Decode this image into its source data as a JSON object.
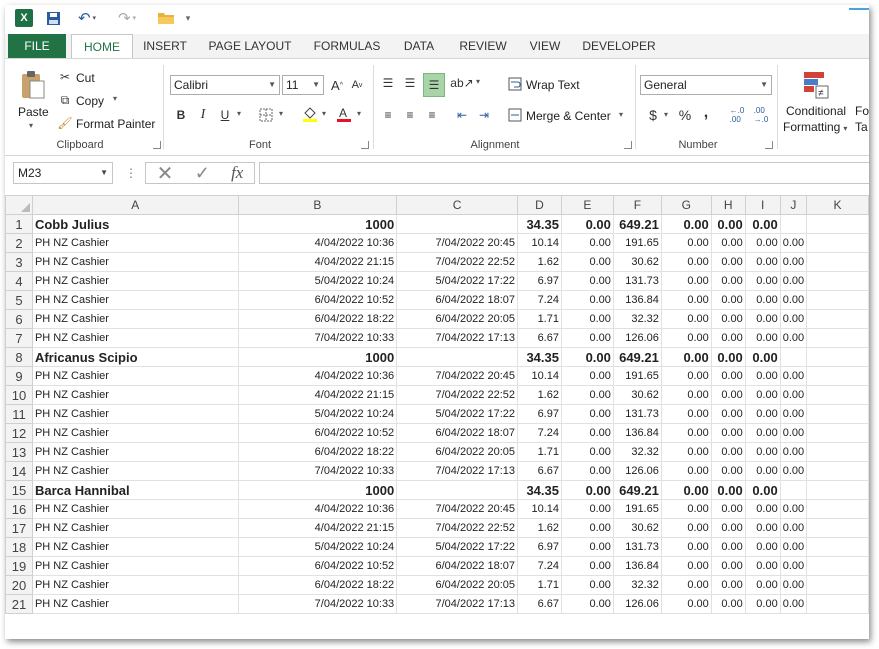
{
  "quick_access": {
    "excel_logo": "X"
  },
  "tabs": [
    "FILE",
    "HOME",
    "INSERT",
    "PAGE LAYOUT",
    "FORMULAS",
    "DATA",
    "REVIEW",
    "VIEW",
    "DEVELOPER"
  ],
  "ribbon": {
    "clipboard": {
      "paste": "Paste",
      "cut": "Cut",
      "copy": "Copy",
      "format_painter": "Format Painter",
      "label": "Clipboard"
    },
    "font": {
      "name": "Calibri",
      "size": "11",
      "bold": "B",
      "italic": "I",
      "underline": "U",
      "label": "Font"
    },
    "alignment": {
      "wrap_text": "Wrap Text",
      "merge_center": "Merge & Center",
      "label": "Alignment"
    },
    "number": {
      "format": "General",
      "currency": "$",
      "percent": "%",
      "comma": ",",
      "label": "Number"
    },
    "styles": {
      "conditional_formatting_1": "Conditional",
      "conditional_formatting_2": "Formatting",
      "format_as_1": "Fo",
      "format_as_2": "Ta"
    }
  },
  "formula_bar": {
    "name_box": "M23",
    "fx": "fx",
    "formula": ""
  },
  "columns": [
    "A",
    "B",
    "C",
    "D",
    "E",
    "F",
    "G",
    "H",
    "I",
    "J",
    "K"
  ],
  "rows": [
    {
      "n": "1",
      "hdr": true,
      "cells": [
        "Cobb Julius",
        "1000",
        "",
        "34.35",
        "0.00",
        "649.21",
        "0.00",
        "0.00",
        "0.00",
        "",
        ""
      ]
    },
    {
      "n": "2",
      "hdr": false,
      "cells": [
        "PH NZ Cashier",
        "4/04/2022 10:36",
        "7/04/2022 20:45",
        "10.14",
        "0.00",
        "191.65",
        "0.00",
        "0.00",
        "0.00",
        "0.00",
        ""
      ]
    },
    {
      "n": "3",
      "hdr": false,
      "cells": [
        "PH NZ Cashier",
        "4/04/2022 21:15",
        "7/04/2022 22:52",
        "1.62",
        "0.00",
        "30.62",
        "0.00",
        "0.00",
        "0.00",
        "0.00",
        ""
      ]
    },
    {
      "n": "4",
      "hdr": false,
      "cells": [
        "PH NZ Cashier",
        "5/04/2022 10:24",
        "5/04/2022 17:22",
        "6.97",
        "0.00",
        "131.73",
        "0.00",
        "0.00",
        "0.00",
        "0.00",
        ""
      ]
    },
    {
      "n": "5",
      "hdr": false,
      "cells": [
        "PH NZ Cashier",
        "6/04/2022 10:52",
        "6/04/2022 18:07",
        "7.24",
        "0.00",
        "136.84",
        "0.00",
        "0.00",
        "0.00",
        "0.00",
        ""
      ]
    },
    {
      "n": "6",
      "hdr": false,
      "cells": [
        "PH NZ Cashier",
        "6/04/2022 18:22",
        "6/04/2022 20:05",
        "1.71",
        "0.00",
        "32.32",
        "0.00",
        "0.00",
        "0.00",
        "0.00",
        ""
      ]
    },
    {
      "n": "7",
      "hdr": false,
      "cells": [
        "PH NZ Cashier",
        "7/04/2022 10:33",
        "7/04/2022 17:13",
        "6.67",
        "0.00",
        "126.06",
        "0.00",
        "0.00",
        "0.00",
        "0.00",
        ""
      ]
    },
    {
      "n": "8",
      "hdr": true,
      "cells": [
        "Africanus Scipio",
        "1000",
        "",
        "34.35",
        "0.00",
        "649.21",
        "0.00",
        "0.00",
        "0.00",
        "",
        ""
      ]
    },
    {
      "n": "9",
      "hdr": false,
      "cells": [
        "PH NZ Cashier",
        "4/04/2022 10:36",
        "7/04/2022 20:45",
        "10.14",
        "0.00",
        "191.65",
        "0.00",
        "0.00",
        "0.00",
        "0.00",
        ""
      ]
    },
    {
      "n": "10",
      "hdr": false,
      "cells": [
        "PH NZ Cashier",
        "4/04/2022 21:15",
        "7/04/2022 22:52",
        "1.62",
        "0.00",
        "30.62",
        "0.00",
        "0.00",
        "0.00",
        "0.00",
        ""
      ]
    },
    {
      "n": "11",
      "hdr": false,
      "cells": [
        "PH NZ Cashier",
        "5/04/2022 10:24",
        "5/04/2022 17:22",
        "6.97",
        "0.00",
        "131.73",
        "0.00",
        "0.00",
        "0.00",
        "0.00",
        ""
      ]
    },
    {
      "n": "12",
      "hdr": false,
      "cells": [
        "PH NZ Cashier",
        "6/04/2022 10:52",
        "6/04/2022 18:07",
        "7.24",
        "0.00",
        "136.84",
        "0.00",
        "0.00",
        "0.00",
        "0.00",
        ""
      ]
    },
    {
      "n": "13",
      "hdr": false,
      "cells": [
        "PH NZ Cashier",
        "6/04/2022 18:22",
        "6/04/2022 20:05",
        "1.71",
        "0.00",
        "32.32",
        "0.00",
        "0.00",
        "0.00",
        "0.00",
        ""
      ]
    },
    {
      "n": "14",
      "hdr": false,
      "cells": [
        "PH NZ Cashier",
        "7/04/2022 10:33",
        "7/04/2022 17:13",
        "6.67",
        "0.00",
        "126.06",
        "0.00",
        "0.00",
        "0.00",
        "0.00",
        ""
      ]
    },
    {
      "n": "15",
      "hdr": true,
      "cells": [
        "Barca Hannibal",
        "1000",
        "",
        "34.35",
        "0.00",
        "649.21",
        "0.00",
        "0.00",
        "0.00",
        "",
        ""
      ]
    },
    {
      "n": "16",
      "hdr": false,
      "cells": [
        "PH NZ Cashier",
        "4/04/2022 10:36",
        "7/04/2022 20:45",
        "10.14",
        "0.00",
        "191.65",
        "0.00",
        "0.00",
        "0.00",
        "0.00",
        ""
      ]
    },
    {
      "n": "17",
      "hdr": false,
      "cells": [
        "PH NZ Cashier",
        "4/04/2022 21:15",
        "7/04/2022 22:52",
        "1.62",
        "0.00",
        "30.62",
        "0.00",
        "0.00",
        "0.00",
        "0.00",
        ""
      ]
    },
    {
      "n": "18",
      "hdr": false,
      "cells": [
        "PH NZ Cashier",
        "5/04/2022 10:24",
        "5/04/2022 17:22",
        "6.97",
        "0.00",
        "131.73",
        "0.00",
        "0.00",
        "0.00",
        "0.00",
        ""
      ]
    },
    {
      "n": "19",
      "hdr": false,
      "cells": [
        "PH NZ Cashier",
        "6/04/2022 10:52",
        "6/04/2022 18:07",
        "7.24",
        "0.00",
        "136.84",
        "0.00",
        "0.00",
        "0.00",
        "0.00",
        ""
      ]
    },
    {
      "n": "20",
      "hdr": false,
      "cells": [
        "PH NZ Cashier",
        "6/04/2022 18:22",
        "6/04/2022 20:05",
        "1.71",
        "0.00",
        "32.32",
        "0.00",
        "0.00",
        "0.00",
        "0.00",
        ""
      ]
    },
    {
      "n": "21",
      "hdr": false,
      "cells": [
        "PH NZ Cashier",
        "7/04/2022 10:33",
        "7/04/2022 17:13",
        "6.67",
        "0.00",
        "126.06",
        "0.00",
        "0.00",
        "0.00",
        "0.00",
        ""
      ]
    }
  ],
  "colors": {
    "excel_green": "#217346",
    "font_color_red": "#e81123",
    "highlight_yellow": "#ffff00"
  }
}
